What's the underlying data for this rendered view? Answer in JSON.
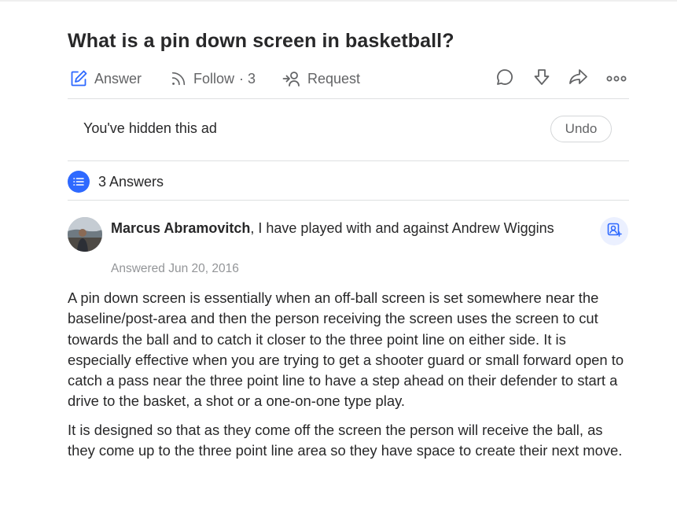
{
  "question": {
    "title": "What is a pin down screen in basketball?"
  },
  "actions": {
    "answer_label": "Answer",
    "follow_label": "Follow",
    "follow_count": "· 3",
    "request_label": "Request",
    "icons": {
      "answer": "pencil-square-icon",
      "follow": "rss-icon",
      "request": "request-user-icon",
      "comment": "comment-icon",
      "downvote": "downvote-arrow-icon",
      "share": "share-arrow-icon",
      "more": "more-dots-icon"
    }
  },
  "ad_notice": {
    "text": "You've hidden this ad",
    "undo_label": "Undo"
  },
  "answers_header": {
    "count_label": "3 Answers",
    "icon": "list-icon"
  },
  "answer": {
    "author_name": "Marcus Abramovitch",
    "credential": ", I have played with and against Andrew Wiggins",
    "answered_date": "Answered Jun 20, 2016",
    "paragraphs": [
      "A pin down screen is essentially when an off-ball screen is set somewhere near the baseline/post-area and then the person receiving the screen uses the screen to cut towards the ball and to catch it closer to the three point line on either side. It is especially effective when you are trying to get a shooter guard or small forward open to catch a pass near the three point line to have a step ahead on their defender to start a drive to the basket, a shot or a one-on-one type play.",
      "It is designed so that as they come off the screen the person will receive the ball, as they come up to the three point line area so they have space to create their next move."
    ]
  },
  "colors": {
    "accent": "#2e69ff",
    "text": "#282829",
    "muted": "#636466",
    "date": "#939598",
    "divider": "#dee0e1"
  }
}
